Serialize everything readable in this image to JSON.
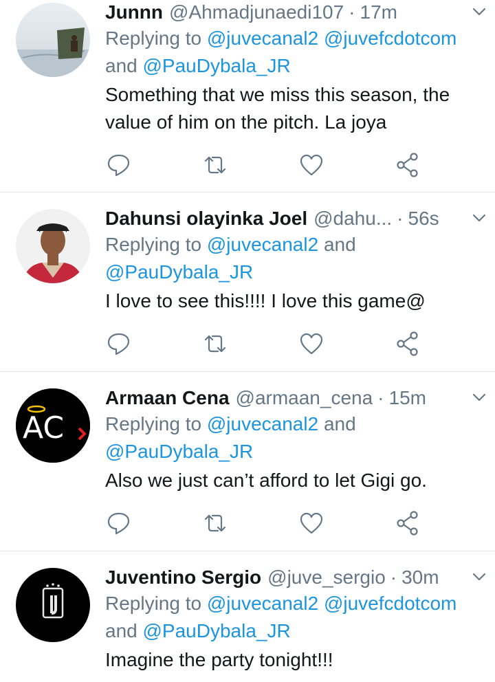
{
  "replying_word": "Replying to",
  "and_word": "and",
  "tweets": [
    {
      "name": "Junnn",
      "handle": "@Ahmadjunaedi107",
      "time": "17m",
      "mentions": [
        "@juvecanal2",
        "@juvefcdotcom",
        "@PauDybala_JR"
      ],
      "text": "Something that we miss this season, the value of him on the pitch. La joya"
    },
    {
      "name": "Dahunsi olayinka Joel",
      "handle": "@dahu...",
      "time": "56s",
      "mentions": [
        "@juvecanal2",
        "@PauDybala_JR"
      ],
      "text": "I love to see this!!!! I love this game@"
    },
    {
      "name": "Armaan Cena",
      "handle": "@armaan_cena",
      "time": "15m",
      "mentions": [
        "@juvecanal2",
        "@PauDybala_JR"
      ],
      "text": "Also we just can’t afford to let Gigi go.",
      "avatar_text": "AC"
    },
    {
      "name": "Juventino Sergio",
      "handle": "@juve_sergio",
      "time": "30m",
      "mentions": [
        "@juvecanal2",
        "@juvefcdotcom",
        "@PauDybala_JR"
      ],
      "text": "Imagine the party tonight!!!"
    }
  ],
  "icons": [
    "reply-icon",
    "retweet-icon",
    "like-icon",
    "share-icon",
    "chevron-down-icon"
  ],
  "colors": {
    "link": "#1b95e0",
    "muted": "#657786",
    "text": "#14171a",
    "divider": "#e1e8ed"
  }
}
